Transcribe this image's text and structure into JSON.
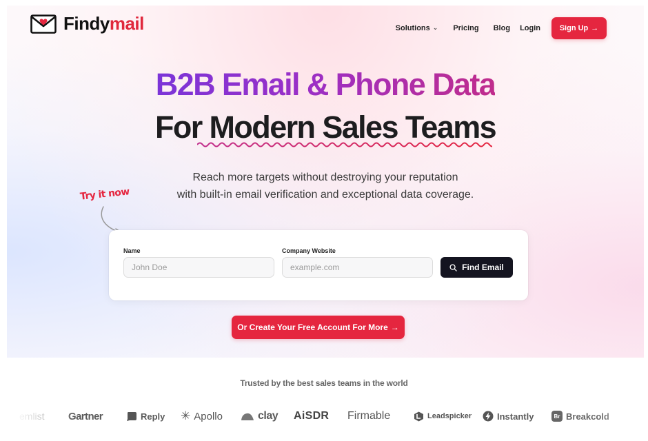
{
  "brand": {
    "name_main": "Findy",
    "name_accent": "mail",
    "icon": "envelope-heart-icon",
    "accent_color": "#e5263f"
  },
  "nav": {
    "items": [
      {
        "label": "Solutions",
        "has_dropdown": true
      },
      {
        "label": "Pricing"
      },
      {
        "label": "Blog"
      },
      {
        "label": "Login"
      }
    ],
    "signup_label": "Sign Up",
    "signup_arrow": "→"
  },
  "hero": {
    "headline_line1": "B2B Email & Phone Data",
    "headline_line2": "For Modern Sales Teams",
    "subtext_line1": "Reach more targets without destroying your reputation",
    "subtext_line2": "with built-in email verification and exceptional data coverage.",
    "try_now": "Try it now"
  },
  "form": {
    "name_label": "Name",
    "name_placeholder": "John Doe",
    "company_label": "Company Website",
    "company_placeholder": "example.com",
    "submit_label": "Find Email",
    "submit_icon": "search-icon"
  },
  "cta": {
    "label": "Or Create Your Free Account For More",
    "arrow": "→"
  },
  "trusted": {
    "heading": "Trusted by the best sales teams in the world",
    "logos": [
      {
        "name": "lemlist",
        "shown": "emlist"
      },
      {
        "name": "Gartner",
        "shown": "Gartner"
      },
      {
        "name": "Reply",
        "shown": "Reply"
      },
      {
        "name": "Apollo",
        "shown": "Apollo"
      },
      {
        "name": "clay",
        "shown": "clay"
      },
      {
        "name": "AiSDR",
        "shown": "AiSDR"
      },
      {
        "name": "Firmable",
        "shown": "Firmable"
      },
      {
        "name": "Leadspicker",
        "shown": "Leadspicker"
      },
      {
        "name": "Instantly",
        "shown": "Instantly"
      },
      {
        "name": "Breakcold",
        "shown": "Breakcold"
      }
    ]
  }
}
